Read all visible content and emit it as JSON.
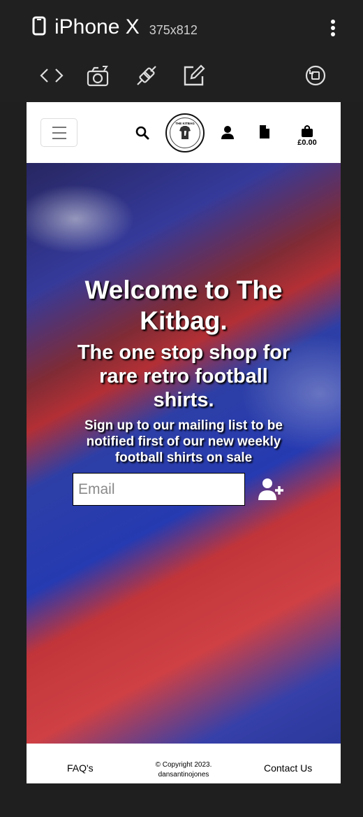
{
  "device": {
    "name": "iPhone X",
    "size": "375x812"
  },
  "site": {
    "cart_total": "£0.00",
    "logo_text": "THE KITBAG"
  },
  "hero": {
    "title": "Welcome to The Kitbag.",
    "subtitle": "The one stop shop for rare retro football shirts.",
    "signup_text": "Sign up to our mailing list to be notified first of our new weekly football shirts on sale",
    "email_placeholder": "Email"
  },
  "footer": {
    "faq": "FAQ's",
    "copyright_line1": "© Copyright 2023.",
    "copyright_line2": "dansantinojones",
    "contact": "Contact Us"
  }
}
